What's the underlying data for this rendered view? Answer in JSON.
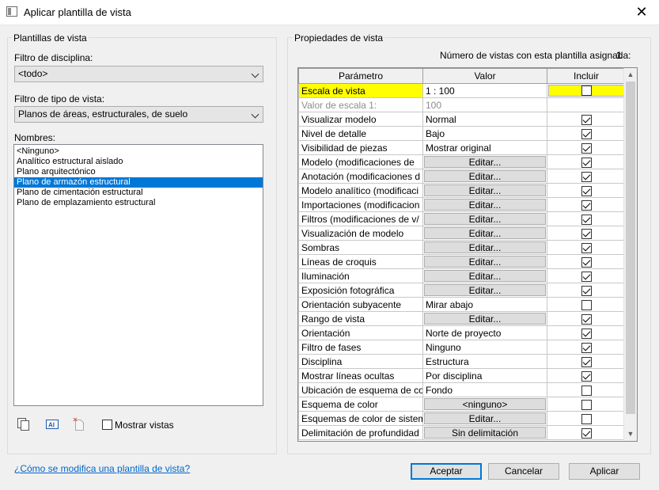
{
  "window": {
    "title": "Aplicar plantilla de vista"
  },
  "left": {
    "group_title": "Plantillas de vista",
    "discipline_label": "Filtro de disciplina:",
    "discipline_value": "<todo>",
    "viewtype_label": "Filtro de tipo de vista:",
    "viewtype_value": "Planos de áreas, estructurales, de suelo",
    "names_label": "Nombres:",
    "names": [
      "<Ninguno>",
      "Analítico estructural aislado",
      "Plano arquitectónico",
      "Plano de armazón estructural",
      "Plano de cimentación estructural",
      "Plano de emplazamiento estructural"
    ],
    "selected_index": 3,
    "show_views_label": "Mostrar vistas"
  },
  "right": {
    "group_title": "Propiedades de vista",
    "assigned_label": "Número de vistas con esta plantilla asignada:",
    "assigned_count": "1",
    "columns": [
      "Parámetro",
      "Valor",
      "Incluir"
    ],
    "rows": [
      {
        "param": "Escala de vista",
        "value": "1 : 100",
        "type": "text",
        "include": false,
        "highlight": true
      },
      {
        "param": "Valor de escala    1:",
        "value": "100",
        "type": "text",
        "include": null,
        "disabled": true
      },
      {
        "param": "Visualizar modelo",
        "value": "Normal",
        "type": "text",
        "include": true
      },
      {
        "param": "Nivel de detalle",
        "value": "Bajo",
        "type": "text",
        "include": true
      },
      {
        "param": "Visibilidad de piezas",
        "value": "Mostrar original",
        "type": "text",
        "include": true
      },
      {
        "param": "Modelo (modificaciones de",
        "value": "Editar...",
        "type": "button",
        "include": true
      },
      {
        "param": "Anotación (modificaciones d",
        "value": "Editar...",
        "type": "button",
        "include": true
      },
      {
        "param": "Modelo analítico (modificaci",
        "value": "Editar...",
        "type": "button",
        "include": true
      },
      {
        "param": "Importaciones (modificacion",
        "value": "Editar...",
        "type": "button",
        "include": true
      },
      {
        "param": "Filtros (modificaciones de v/",
        "value": "Editar...",
        "type": "button",
        "include": true
      },
      {
        "param": "Visualización de modelo",
        "value": "Editar...",
        "type": "button",
        "include": true
      },
      {
        "param": "Sombras",
        "value": "Editar...",
        "type": "button",
        "include": true
      },
      {
        "param": "Líneas de croquis",
        "value": "Editar...",
        "type": "button",
        "include": true
      },
      {
        "param": "Iluminación",
        "value": "Editar...",
        "type": "button",
        "include": true
      },
      {
        "param": "Exposición fotográfica",
        "value": "Editar...",
        "type": "button",
        "include": true
      },
      {
        "param": "Orientación subyacente",
        "value": "Mirar abajo",
        "type": "text",
        "include": false
      },
      {
        "param": "Rango de vista",
        "value": "Editar...",
        "type": "button",
        "include": true
      },
      {
        "param": "Orientación",
        "value": "Norte de proyecto",
        "type": "text",
        "include": true
      },
      {
        "param": "Filtro de fases",
        "value": "Ninguno",
        "type": "text",
        "include": true
      },
      {
        "param": "Disciplina",
        "value": "Estructura",
        "type": "text",
        "include": true
      },
      {
        "param": "Mostrar líneas ocultas",
        "value": "Por disciplina",
        "type": "text",
        "include": true
      },
      {
        "param": "Ubicación de esquema de co",
        "value": "Fondo",
        "type": "text",
        "include": false
      },
      {
        "param": "Esquema de color",
        "value": "<ninguno>",
        "type": "button",
        "include": false
      },
      {
        "param": "Esquemas de color de sistem",
        "value": "Editar...",
        "type": "button",
        "include": false
      },
      {
        "param": "Delimitación de profundidad",
        "value": "Sin delimitación",
        "type": "button",
        "include": true
      }
    ]
  },
  "footer": {
    "help_link": "¿Cómo se modifica una plantilla de vista?",
    "ok": "Aceptar",
    "cancel": "Cancelar",
    "apply": "Aplicar"
  }
}
